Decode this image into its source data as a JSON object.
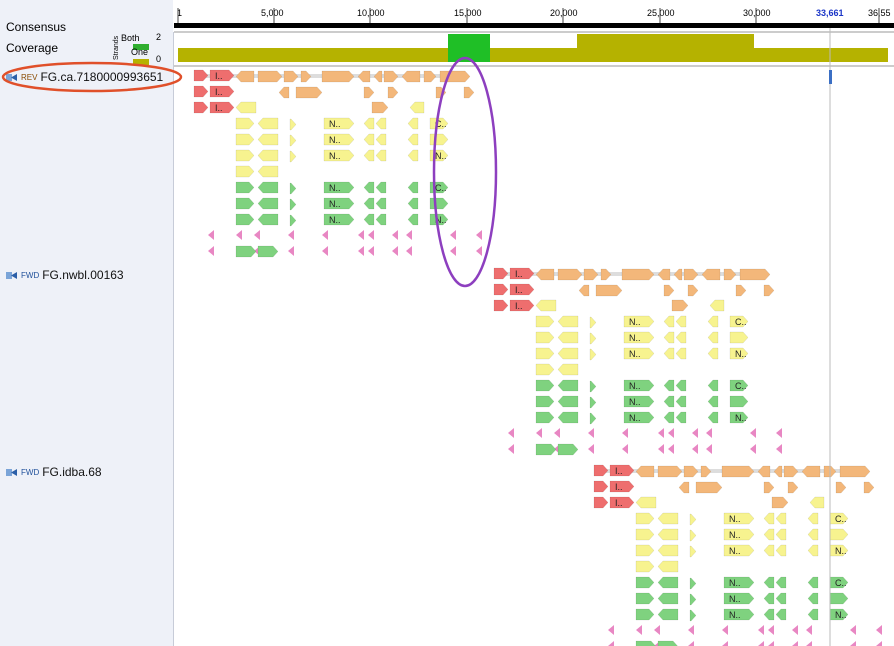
{
  "header": {
    "consensus_label": "Consensus",
    "coverage_label": "Coverage",
    "strands_label": "Strands",
    "coverage_max": "2",
    "coverage_min": "0",
    "legend_both": "Both",
    "legend_one": "One"
  },
  "ruler": {
    "ticks": [
      "1",
      "5,000",
      "10,000",
      "15,000",
      "20,000",
      "25,000",
      "30,000",
      "36,55"
    ],
    "cursor": "33,661"
  },
  "colors": {
    "coverage_olive": "#b5b200",
    "coverage_green": "#1fbf26",
    "both_green": "#2fae2f",
    "red": "#ee6e6e",
    "orange": "#f3b77a",
    "yellow": "#f7f38f",
    "green": "#7fd27f",
    "pink": "#e887c3",
    "annotation_orange": "#e0502a",
    "annotation_purple": "#8d3fbf",
    "cursor_line": "#3b6fc4"
  },
  "contigs": [
    {
      "name": "FG.ca.7180000993651",
      "strand": "REV"
    },
    {
      "name": "FG.nwbl.00163",
      "strand": "FWD"
    },
    {
      "name": "FG.idba.68",
      "strand": "FWD"
    }
  ]
}
